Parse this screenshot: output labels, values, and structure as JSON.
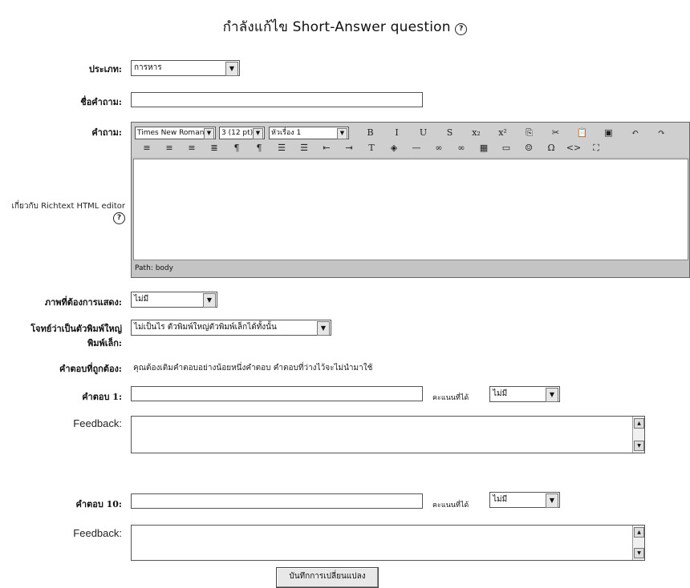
{
  "page": {
    "title": "กำลังแก้ไข Short-Answer question",
    "title_help": "?"
  },
  "category": {
    "label": "ประเภท:",
    "value": "การหาร"
  },
  "question_name": {
    "label": "ชื่อคำถาม:",
    "value": ""
  },
  "question_text": {
    "label": "คำถาม:",
    "help_text": "เกี่ยวกับ Richtext HTML editor",
    "font_select": "Times New Roman",
    "size_select": "3 (12 pt)",
    "format_select": "หัวเรื่อง 1",
    "toolbar_row1": [
      "B",
      "I",
      "U",
      "S",
      "x₂",
      "x²",
      "⎘",
      "✂",
      "📋",
      "▣",
      "↶",
      "↷"
    ],
    "toolbar_row2": [
      "≡",
      "≡",
      "≡",
      "≣",
      "¶",
      "¶",
      "☰",
      "☰",
      "⇤",
      "⇥",
      "T",
      "◈",
      "—",
      "∞",
      "∞",
      "▦",
      "▭",
      "☺",
      "Ω",
      "<>",
      "⛶"
    ],
    "path_label": "Path:",
    "path_value": "body"
  },
  "image": {
    "label": "ภาพที่ต้องการแสดง:",
    "value": "ไม่มี"
  },
  "case_sensitive": {
    "label_line1": "โจทย์ว่าเป็นตัวพิมพ์ใหญ่",
    "label_line2": "พิมพ์เล็ก:",
    "value": "ไม่เป็นไร ตัวพิมพ์ใหญ่ตัวพิมพ์เล็กได้ทั้งนั้น"
  },
  "correct_answers": {
    "label": "คำตอบที่ถูกต้อง:",
    "note": "คุณต้องเติมคำตอบอย่างน้อยหนึ่งคำตอบ คำตอบที่ว่างไว้จะไม่นำมาใช้"
  },
  "answers": [
    {
      "label": "คำตอบ 1:",
      "value": "",
      "grade_label": "คะแนนที่ได้",
      "grade_value": "ไม่มี",
      "feedback_label": "Feedback:",
      "feedback_value": ""
    },
    {
      "label": "คำตอบ 10:",
      "value": "",
      "grade_label": "คะแนนที่ได้",
      "grade_value": "ไม่มี",
      "feedback_label": "Feedback:",
      "feedback_value": ""
    }
  ],
  "save_button": {
    "label": "บันทึกการเปลี่ยนแปลง"
  }
}
